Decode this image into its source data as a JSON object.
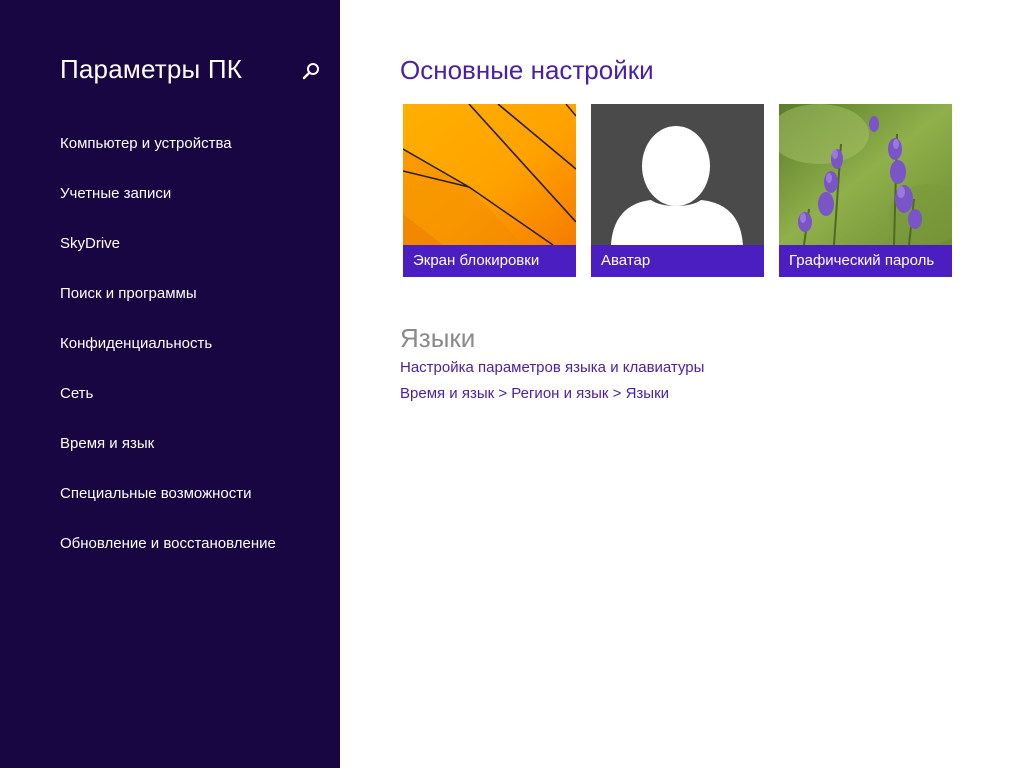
{
  "sidebar": {
    "title": "Параметры ПК",
    "search_icon": "search-icon",
    "items": [
      {
        "label": "Компьютер и устройства"
      },
      {
        "label": "Учетные записи"
      },
      {
        "label": "SkyDrive"
      },
      {
        "label": "Поиск и программы"
      },
      {
        "label": "Конфиденциальность"
      },
      {
        "label": "Сеть"
      },
      {
        "label": "Время и язык"
      },
      {
        "label": "Специальные возможности"
      },
      {
        "label": "Обновление и восстановление"
      }
    ]
  },
  "main": {
    "title": "Основные настройки",
    "tiles": [
      {
        "label": "Экран блокировки",
        "image": "orange-abstract-lines"
      },
      {
        "label": "Аватар",
        "image": "default-user-avatar"
      },
      {
        "label": "Графический пароль",
        "image": "lavender-flowers"
      }
    ],
    "languages": {
      "title": "Языки",
      "link_settings": "Настройка параметров языка и клавиатуры",
      "link_path": "Время и язык > Регион и язык > Языки"
    }
  },
  "colors": {
    "sidebar_bg": "#180642",
    "accent": "#4b1ec2",
    "link": "#4a1ea5"
  }
}
